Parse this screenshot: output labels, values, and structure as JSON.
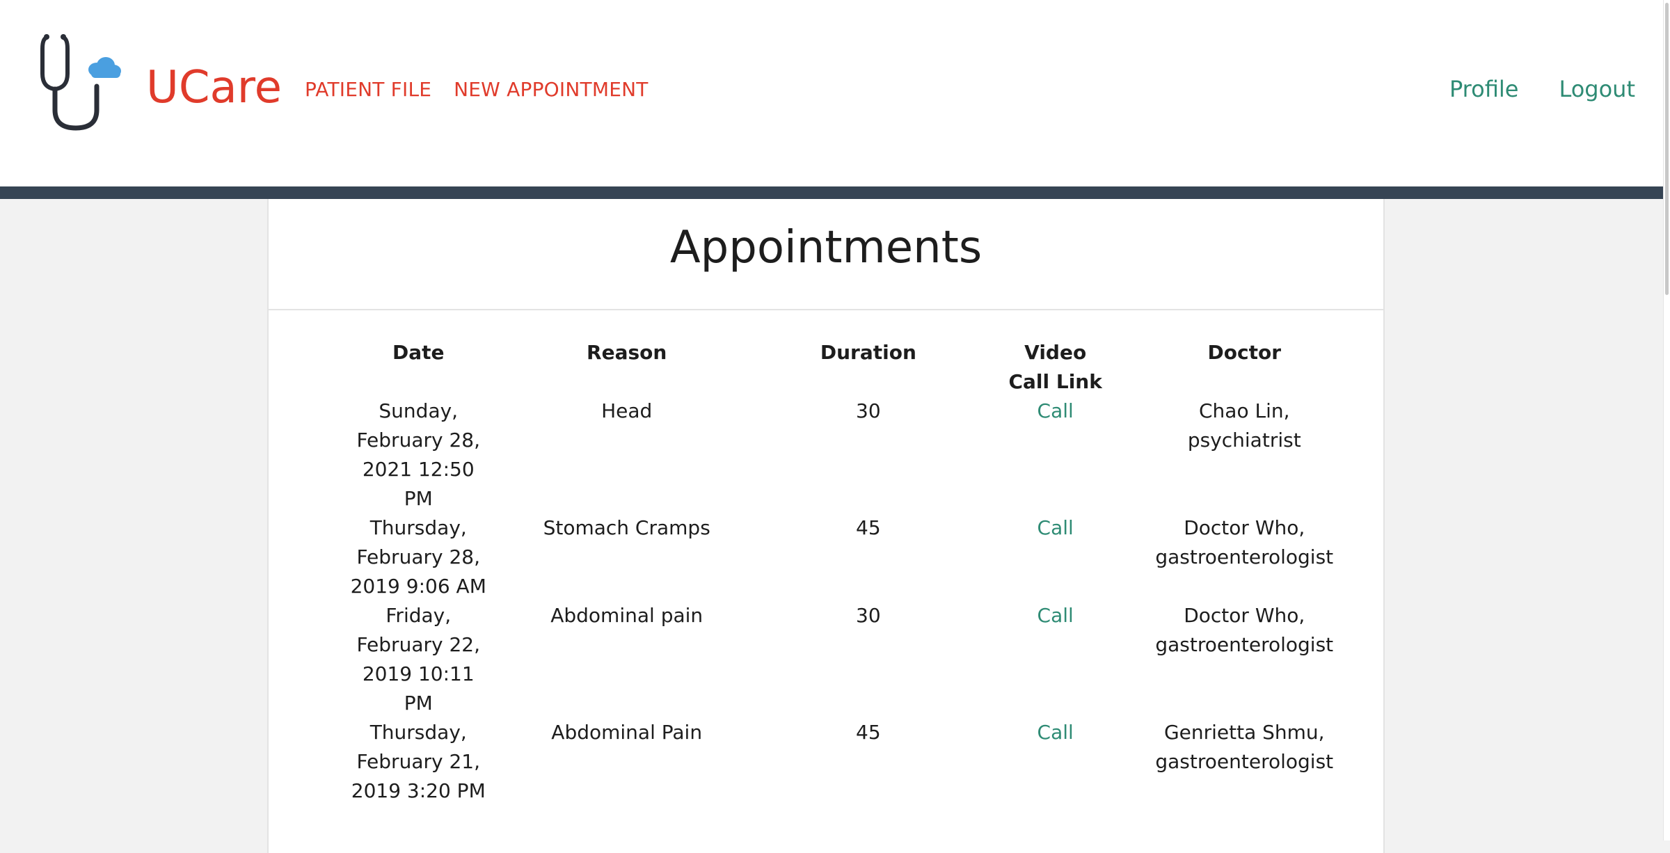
{
  "app": {
    "brand": "UCare",
    "logo_icon": "stethoscope-cloud-icon",
    "colors": {
      "brand_red": "#e03b2b",
      "link_green": "#2e8b74",
      "header_bar": "#364454",
      "logo_dark": "#2a2e37",
      "logo_cloud": "#4a9fe0"
    }
  },
  "nav": {
    "patient_file": "PATIENT FILE",
    "new_appointment": "NEW APPOINTMENT",
    "profile": "Profile",
    "logout": "Logout"
  },
  "page": {
    "title": "Appointments"
  },
  "table": {
    "headers": {
      "date": "Date",
      "reason": "Reason",
      "duration": "Duration",
      "video": "Video Call Link",
      "doctor": "Doctor"
    },
    "rows": [
      {
        "date": "Sunday, February 28, 2021 12:50 PM",
        "reason": "Head",
        "duration": "30",
        "video": "Call",
        "doctor": "Chao Lin, psychiatrist"
      },
      {
        "date": "Thursday, February 28, 2019 9:06 AM",
        "reason": "Stomach Cramps",
        "duration": "45",
        "video": "Call",
        "doctor": "Doctor Who, gastroenterologist"
      },
      {
        "date": "Friday, February 22, 2019 10:11 PM",
        "reason": "Abdominal pain",
        "duration": "30",
        "video": "Call",
        "doctor": "Doctor Who, gastroenterologist"
      },
      {
        "date": "Thursday, February 21, 2019 3:20 PM",
        "reason": "Abdominal Pain",
        "duration": "45",
        "video": "Call",
        "doctor": "Genrietta Shmu, gastroenterologist"
      }
    ]
  }
}
